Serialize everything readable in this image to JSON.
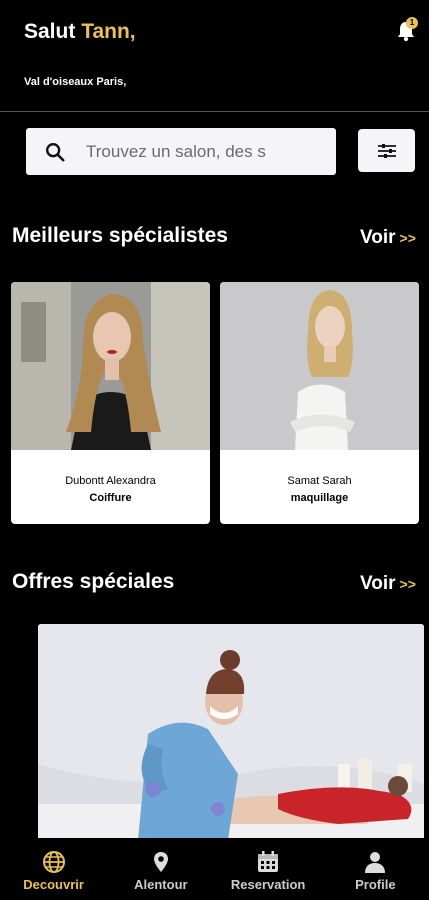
{
  "header": {
    "greeting_prefix": "Salut",
    "user_name": "Tann,",
    "notification_count": "1",
    "location": "Val d'oiseaux Paris,"
  },
  "search": {
    "placeholder": "Trouvez un salon, des s"
  },
  "specialists": {
    "title": "Meilleurs spécialistes",
    "see_all": "Voir",
    "arrows": ">>",
    "items": [
      {
        "name": "Dubontt Alexandra",
        "specialty": "Coiffure"
      },
      {
        "name": "Samat Sarah",
        "specialty": "maquillage"
      }
    ]
  },
  "offers": {
    "title": "Offres spéciales",
    "see_all": "Voir",
    "arrows": ">>"
  },
  "nav": {
    "items": [
      {
        "label": "Decouvrir",
        "icon": "globe-icon",
        "active": true
      },
      {
        "label": "Alentour",
        "icon": "location-pin-icon",
        "active": false
      },
      {
        "label": "Reservation",
        "icon": "calendar-icon",
        "active": false
      },
      {
        "label": "Profile",
        "icon": "user-icon",
        "active": false
      }
    ]
  },
  "colors": {
    "accent": "#E8C15A",
    "background": "#000000",
    "surface": "#F5F5F7"
  }
}
